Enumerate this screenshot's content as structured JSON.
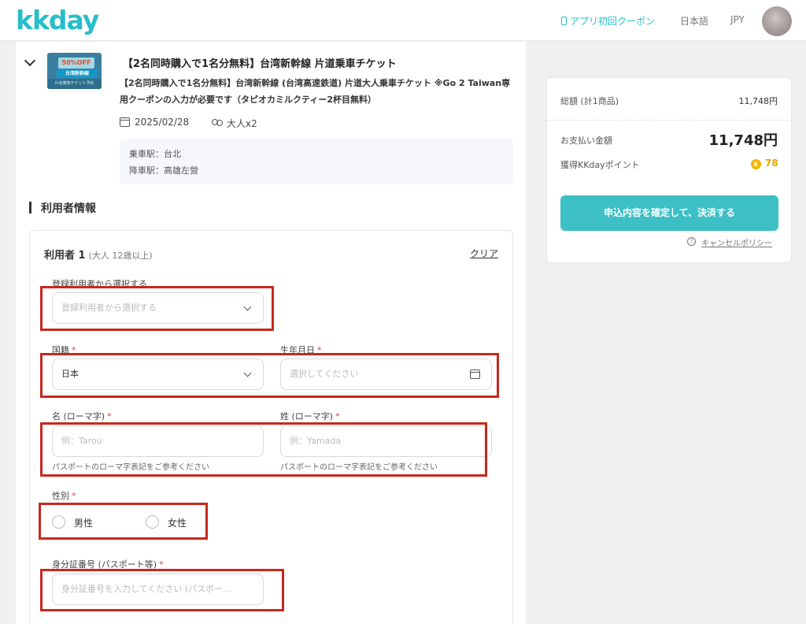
{
  "header": {
    "logo": "kkday",
    "app_coupon": "アプリ初回クーポン",
    "language": "日本語",
    "currency": "JPY"
  },
  "product": {
    "thumb_badge": "50%OFF",
    "thumb_title": "台湾新幹線",
    "thumb_sub": "片道乗車チケット予約",
    "title": "【2名同時購入で1名分無料】台湾新幹線 片道乗車チケット",
    "description": "【2名同時購入で1名分無料】台湾新幹線 (台湾高速鉄道) 片道大人乗車チケット ※Go 2 Taiwan専用クーポンの入力が必要です（タピオカミルクティー2杯目無料）",
    "date": "2025/02/28",
    "people": "大人x2",
    "departure": "乗車駅：台北",
    "arrival": "降車駅：高雄左營"
  },
  "section": {
    "title": "利用者情報"
  },
  "user_form": {
    "heading": "利用者 1",
    "heading_sub": "(大人 12歳以上)",
    "clear": "クリア",
    "saved_user_label": "登録利用者から選択する",
    "saved_user_placeholder": "登録利用者から選択する",
    "nationality_label": "国籍",
    "nationality_value": "日本",
    "birthday_label": "生年月日",
    "birthday_placeholder": "選択してください",
    "first_name_label": "名 (ローマ字)",
    "first_name_placeholder": "例：Tarou",
    "last_name_label": "姓 (ローマ字)",
    "last_name_placeholder": "例：Yamada",
    "romaji_hint": "パスポートのローマ字表記をご参考ください",
    "gender_label": "性別",
    "gender_male": "男性",
    "gender_female": "女性",
    "id_label": "身分証番号 (パスポート等)",
    "id_placeholder": "身分証番号を入力してください (パスポー…",
    "required_mark": "*"
  },
  "summary": {
    "total_label": "総額 (計1商品)",
    "total_value": "11,748円",
    "payment_label": "お支払い金額",
    "payment_value": "11,748円",
    "points_label": "獲得KKdayポイント",
    "points_value": "78",
    "coin_symbol": "k",
    "pay_button": "申込内容を確定して、決済する",
    "cancel_policy": "キャンセルポリシー"
  },
  "colors": {
    "brand": "#26bec9",
    "button": "#3cc0c6",
    "highlight_box": "#c8281e",
    "required": "#e53935",
    "points": "#e0a800"
  }
}
